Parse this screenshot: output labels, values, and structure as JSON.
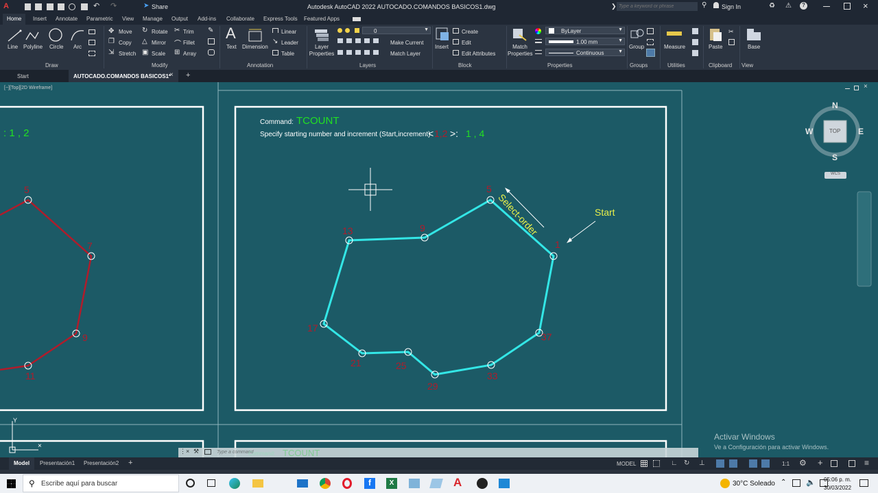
{
  "app": {
    "title": "Autodesk AutoCAD 2022    AUTOCADO.COMANDOS BASICOS1.dwg",
    "share_label": "Share",
    "search_placeholder": "Type a keyword or phrase",
    "sign_in": "Sign In"
  },
  "ribbon_tabs": [
    "Home",
    "Insert",
    "Annotate",
    "Parametric",
    "View",
    "Manage",
    "Output",
    "Add-ins",
    "Collaborate",
    "Express Tools",
    "Featured Apps"
  ],
  "ribbon": {
    "draw": {
      "line": "Line",
      "polyline": "Polyline",
      "circle": "Circle",
      "arc": "Arc",
      "group": "Draw"
    },
    "modify": {
      "move": "Move",
      "rotate": "Rotate",
      "trim": "Trim",
      "copy": "Copy",
      "mirror": "Mirror",
      "fillet": "Fillet",
      "stretch": "Stretch",
      "scale": "Scale",
      "array": "Array",
      "group": "Modify"
    },
    "annotation": {
      "text": "Text",
      "dimension": "Dimension",
      "linear": "Linear",
      "leader": "Leader",
      "table": "Table",
      "group": "Annotation"
    },
    "layers": {
      "layer_properties": "Layer Properties",
      "layer_value": "0",
      "make_current": "Make Current",
      "match_layer": "Match Layer",
      "group": "Layers"
    },
    "block": {
      "insert": "Insert",
      "create": "Create",
      "edit": "Edit",
      "edit_attributes": "Edit Attributes",
      "group": "Block"
    },
    "properties": {
      "match_properties": "Match Properties",
      "color": "ByLayer",
      "lineweight": "1.00 mm",
      "linetype": "Continuous",
      "group": "Properties"
    },
    "groups": {
      "group": "Group",
      "group_label": "Groups"
    },
    "utilities": {
      "measure": "Measure",
      "group": "Utilities"
    },
    "clipboard": {
      "paste": "Paste",
      "group": "Clipboard"
    },
    "view": {
      "base": "Base",
      "group": "View"
    }
  },
  "doc_tabs": {
    "start": "Start",
    "active": "AUTOCADO.COMANDOS BASICOS1*"
  },
  "viewport": {
    "label": "[−][Top][2D Wireframe]"
  },
  "drawing": {
    "command_label": "Command:",
    "command_name": "TCOUNT",
    "prompt": "Specify starting number and increment (Start,increment)",
    "prompt_default": "1,2",
    "prompt_value": "1 , 4",
    "left_value": ": 1 , 2",
    "select_order": "Select-order",
    "start": "Start",
    "right_numbers": [
      "1",
      "5",
      "9",
      "13",
      "17",
      "21",
      "25",
      "29",
      "33",
      "37"
    ],
    "left_numbers": [
      "5",
      "7",
      "9",
      "11"
    ],
    "cyan": "#33e6e6",
    "red": "#b01c2b"
  },
  "viewcube": {
    "n": "N",
    "s": "S",
    "e": "E",
    "w": "W",
    "top": "TOP",
    "wcs": "WCS"
  },
  "command_line": {
    "placeholder": "Type a command",
    "ghost_cmd": "Command:",
    "ghost_name": "TCOUNT"
  },
  "watermark": {
    "title": "Activar Windows",
    "subtitle": "Ve a Configuración para activar Windows."
  },
  "layout_tabs": {
    "model": "Model",
    "p1": "Presentación1",
    "p2": "Presentación2"
  },
  "statusbar": {
    "model": "MODEL",
    "scale": "1:1"
  },
  "taskbar": {
    "search": "Escribe aquí para buscar",
    "weather": "30°C  Soleado",
    "time": "05:06 p. m.",
    "date": "30/03/2022"
  }
}
